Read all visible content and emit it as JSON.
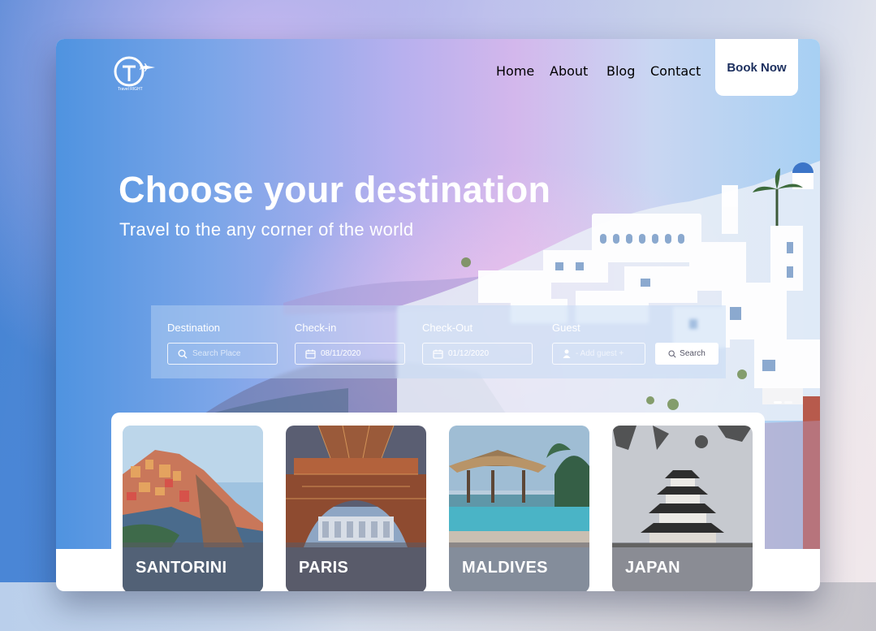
{
  "brand": {
    "logo_text": "Travel RIGHT",
    "logo_letters": "GT"
  },
  "nav": {
    "items": [
      {
        "label": "Home"
      },
      {
        "label": "About"
      },
      {
        "label": "Blog"
      },
      {
        "label": "Contact"
      }
    ],
    "book_now": "Book Now"
  },
  "hero": {
    "title": "Choose your destination",
    "subtitle": "Travel to the any corner of the world"
  },
  "search": {
    "destination": {
      "label": "Destination",
      "placeholder": "Search Place"
    },
    "checkin": {
      "label": "Check-in",
      "value": "08/11/2020"
    },
    "checkout": {
      "label": "Check-Out",
      "value": "01/12/2020"
    },
    "guest": {
      "label": "Guest",
      "placeholder": "- Add guest +"
    },
    "button": "Search"
  },
  "carousel": {
    "active_index": 0,
    "count": 2
  },
  "destinations": [
    {
      "name": "SANTORINI"
    },
    {
      "name": "PARIS"
    },
    {
      "name": "MALDIVES"
    },
    {
      "name": "JAPAN"
    }
  ],
  "colors": {
    "accent": "#1c2f5e",
    "hero_blue": "#4f93e0",
    "hero_pink": "#d3b7ec"
  }
}
